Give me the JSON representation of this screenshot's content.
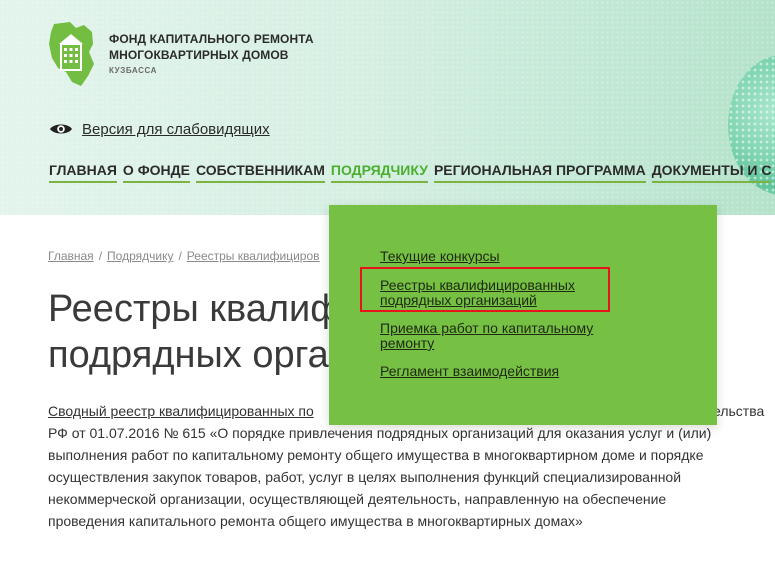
{
  "header": {
    "org_name_lines": [
      "ФОНД КАПИТАЛЬНОГО РЕМОНТА",
      "МНОГОКВАРТИРНЫХ ДОМОВ"
    ],
    "org_region": "КУЗБАССА",
    "vision_link": "Версия для слабовидящих",
    "colors": {
      "brand_green": "#76c043",
      "nav_active": "#4caf2f",
      "highlight_red": "#e8141b"
    }
  },
  "nav": {
    "items": [
      "ГЛАВНАЯ",
      "О ФОНДЕ",
      "СОБСТВЕННИКАМ",
      "ПОДРЯДЧИКУ",
      "РЕГИОНАЛЬНАЯ ПРОГРАММА",
      "ДОКУМЕНТЫ И С"
    ],
    "active": "ПОДРЯДЧИКУ"
  },
  "dropdown": {
    "items": [
      {
        "lines": [
          "Текущие конкурсы"
        ]
      },
      {
        "lines": [
          "Реестры квалифицированных",
          "подрядных организаций"
        ],
        "highlighted": true
      },
      {
        "lines": [
          "Приемка работ по капитальному",
          "ремонту"
        ]
      },
      {
        "lines": [
          "Регламент взаимодействия"
        ]
      }
    ]
  },
  "breadcrumb": {
    "items": [
      "Главная",
      "Подрядчику",
      "Реестры квалифициров"
    ],
    "separator": "/"
  },
  "page": {
    "title_lines": [
      "Реестры квалиф",
      "подрядных орга"
    ]
  },
  "body": {
    "link_text": "Сводный реестр квалифицированных по",
    "first_line_tail": "ельства",
    "lines": [
      "РФ от 01.07.2016 № 615 «О порядке привлечения подрядных организаций для оказания услуг и (или)",
      "выполнения работ по капитальному ремонту общего имущества в многоквартирном доме и порядке",
      "осуществления закупок товаров, работ, услуг в целях выполнения функций специализированной",
      "некоммерческой организации, осуществляющей деятельность, направленную на обеспечение",
      "проведения капитального ремонта общего имущества в многоквартирных домах»"
    ]
  }
}
